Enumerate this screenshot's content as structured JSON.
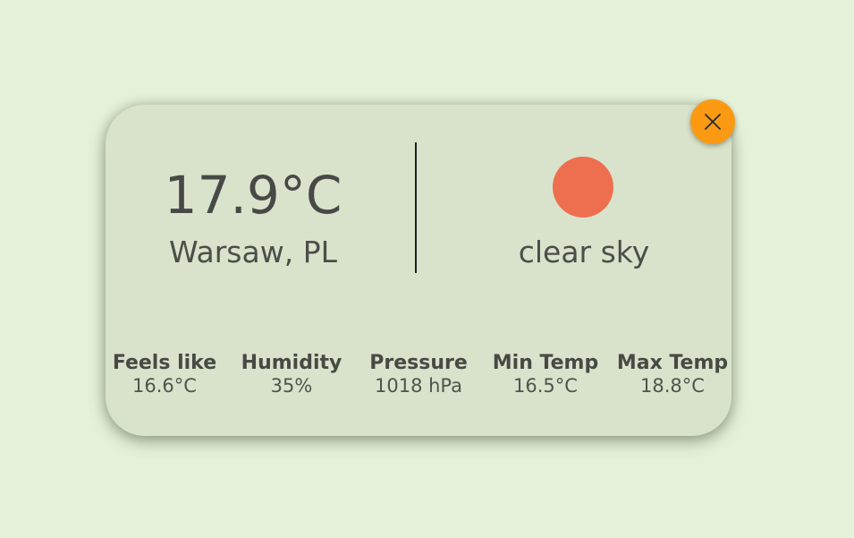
{
  "weather": {
    "temperature": "17.9°C",
    "location": "Warsaw, PL",
    "description": "clear sky",
    "icon": "sun-icon",
    "colors": {
      "background": "#e5f2d9",
      "card": "#d9e3cc",
      "sun": "#ee6f4f",
      "close_button": "#fb9a12"
    }
  },
  "close_button": {
    "icon": "close-icon"
  },
  "stats": [
    {
      "label": "Feels like",
      "value": "16.6°C"
    },
    {
      "label": "Humidity",
      "value": "35%"
    },
    {
      "label": "Pressure",
      "value": "1018 hPa"
    },
    {
      "label": "Min Temp",
      "value": "16.5°C"
    },
    {
      "label": "Max Temp",
      "value": "18.8°C"
    }
  ]
}
